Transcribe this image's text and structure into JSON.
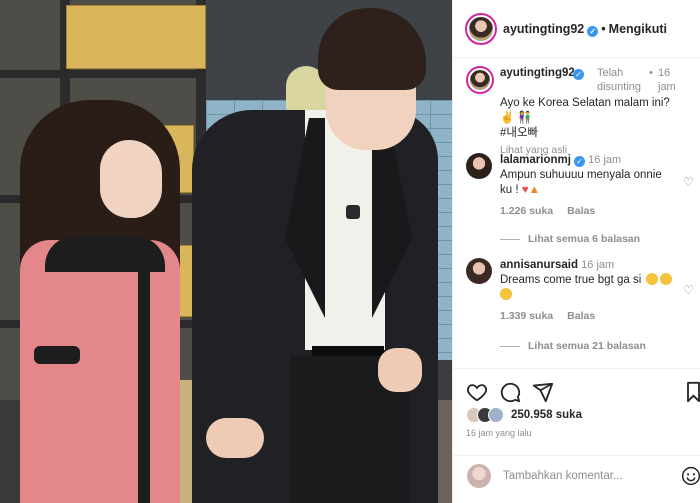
{
  "post": {
    "image_alt": "photo",
    "author": "ayutingting92",
    "follow_status": "Mengikuti",
    "separator": "•"
  },
  "caption": {
    "user": "ayutingting92",
    "edited": "Telah disunting",
    "time": "16 jam",
    "text": "Ayo ke Korea Selatan malam ini? ✌️ 👫",
    "hashtag": "#내오빠",
    "see_original": "Lihat yang asli"
  },
  "comments": [
    {
      "user": "lalamarionmj",
      "time": "16 jam",
      "text": "Ampun suhuuuu menyala onnie ku !",
      "likes": "1.226 suka",
      "reply": "Balas",
      "view_replies": "Lihat semua 6 balasan"
    },
    {
      "user": "annisanursaid",
      "time": "16 jam",
      "text": "Dreams come true bgt ga si",
      "likes": "1.339 suka",
      "reply": "Balas",
      "view_replies": "Lihat semua 21 balasan"
    }
  ],
  "actions": {
    "like_icon": "heart-icon",
    "comment_icon": "comment-icon",
    "share_icon": "share-icon",
    "save_icon": "bookmark-icon",
    "likes_count": "250.958 suka",
    "posted_ago": "16 jam yang lalu"
  },
  "add_comment": {
    "placeholder": "Tambahkan komentar..."
  },
  "colors": {
    "verified": "#3897f0",
    "muted": "#8e8e8e",
    "text": "#262626",
    "heart_emoji": "#ed4956"
  }
}
